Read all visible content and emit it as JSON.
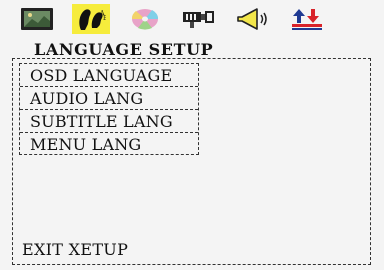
{
  "tabs": [
    {
      "icon": "tv-screen-icon",
      "selected": false
    },
    {
      "icon": "language-faces-icon",
      "selected": true
    },
    {
      "icon": "disc-icon",
      "selected": false
    },
    {
      "icon": "video-connector-icon",
      "selected": false
    },
    {
      "icon": "speaker-icon",
      "selected": false
    },
    {
      "icon": "preferences-arrows-icon",
      "selected": false
    }
  ],
  "colors": {
    "background": "#f4f4f4",
    "selected_tab": "#f6ec3c",
    "text": "#111111",
    "accent_red": "#d8232a",
    "accent_blue": "#1f3a93"
  },
  "page": {
    "title": "LANGUAGE SETUP"
  },
  "menu": {
    "items": [
      {
        "label": "OSD LANGUAGE"
      },
      {
        "label": "AUDIO LANG"
      },
      {
        "label": "SUBTITLE LANG"
      },
      {
        "label": "MENU LANG"
      }
    ]
  },
  "footer": {
    "exit_label": "EXIT XETUP"
  }
}
